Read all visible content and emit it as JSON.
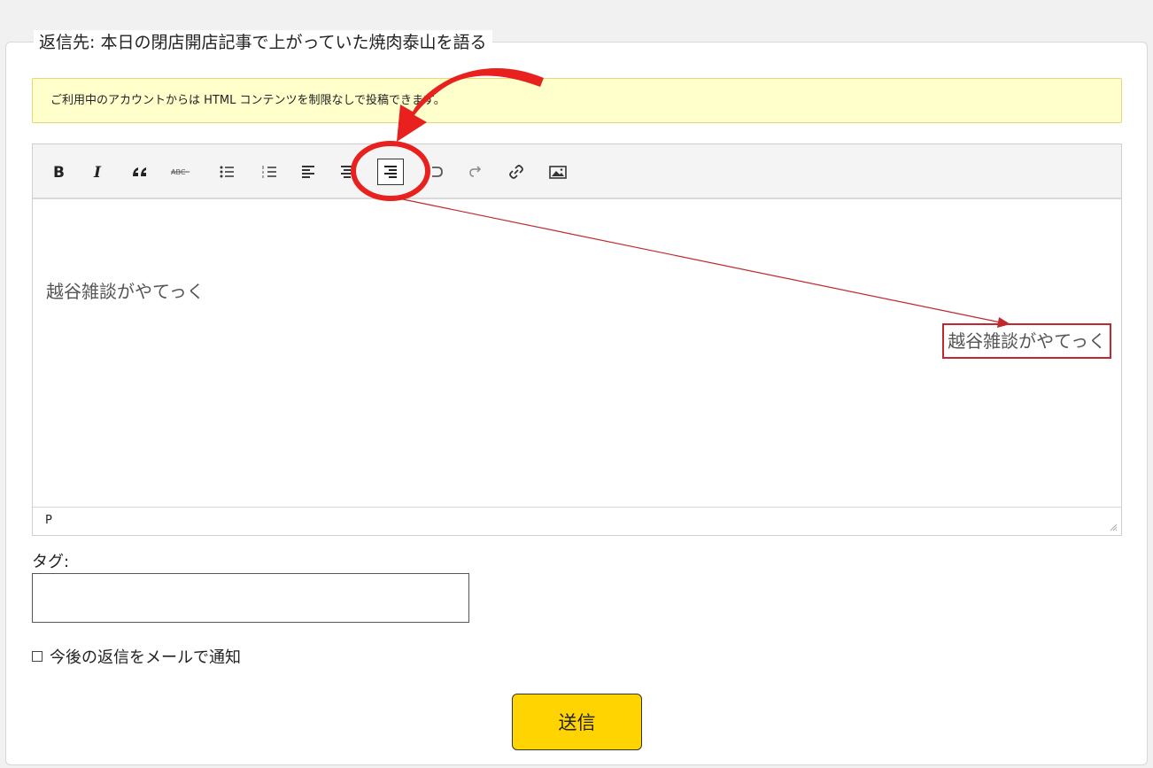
{
  "form": {
    "legend": "返信先: 本日の閉店開店記事で上がっていた焼肉泰山を語る",
    "notice": "ご利用中のアカウントからは HTML コンテンツを制限なしで投稿できます。",
    "editor": {
      "toolbar": [
        {
          "name": "bold-button",
          "icon": "bold-icon"
        },
        {
          "name": "italic-button",
          "icon": "italic-icon"
        },
        {
          "name": "blockquote-button",
          "icon": "quote-icon"
        },
        {
          "name": "strikethrough-button",
          "icon": "strikethrough-icon"
        },
        {
          "name": "bullet-list-button",
          "icon": "bullet-list-icon"
        },
        {
          "name": "numbered-list-button",
          "icon": "numbered-list-icon"
        },
        {
          "name": "align-left-button",
          "icon": "align-left-icon"
        },
        {
          "name": "align-center-button",
          "icon": "align-center-icon"
        },
        {
          "name": "align-right-button",
          "icon": "align-right-icon",
          "active": true
        },
        {
          "name": "undo-button",
          "icon": "undo-icon"
        },
        {
          "name": "redo-button",
          "icon": "redo-icon"
        },
        {
          "name": "link-button",
          "icon": "link-icon"
        },
        {
          "name": "image-button",
          "icon": "image-icon"
        }
      ],
      "paragraph_left": "越谷雑談がやてっく",
      "paragraph_right": "越谷雑談がやてっく",
      "status_path": "P"
    },
    "tags": {
      "label": "タグ:",
      "value": ""
    },
    "notify": {
      "label": "今後の返信をメールで通知",
      "checked": false
    },
    "submit_label": "送信"
  },
  "annotation": {
    "highlight_color": "#e8211e",
    "box_color": "#c0282d"
  }
}
